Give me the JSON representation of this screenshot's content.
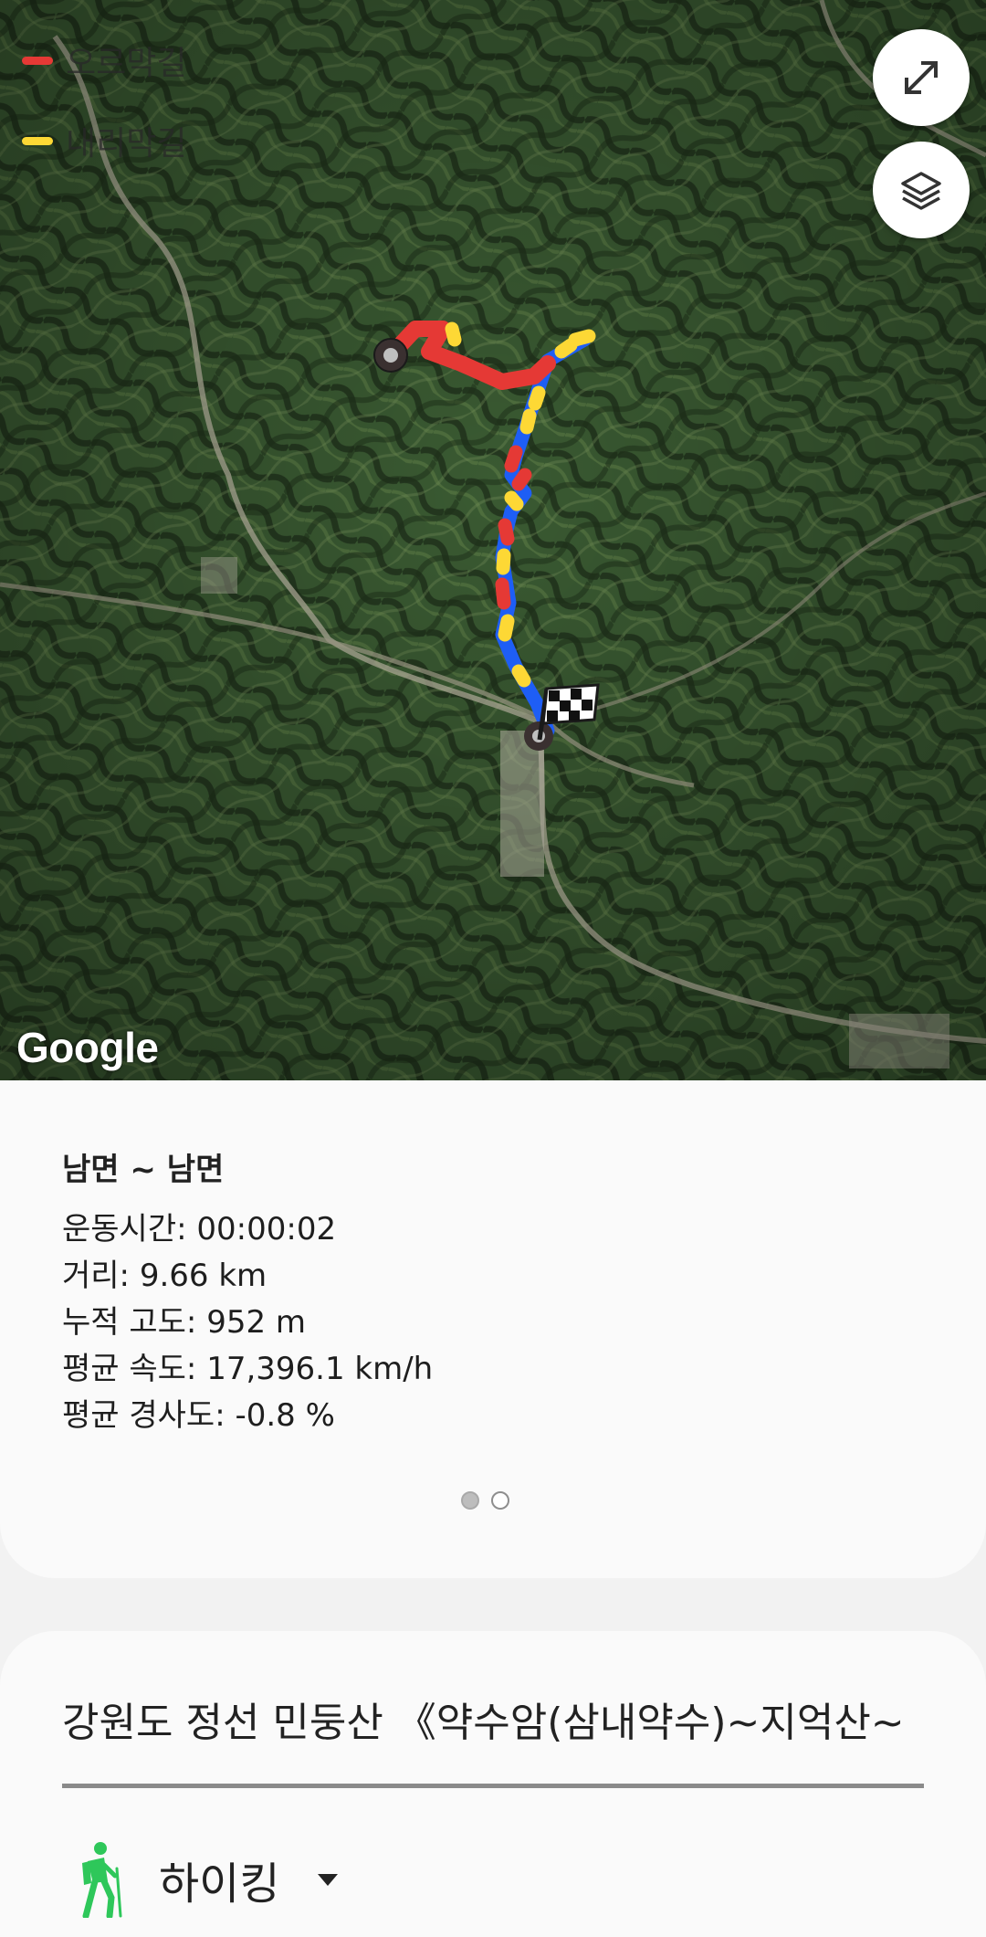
{
  "map": {
    "legend": [
      {
        "label": "오르막길",
        "color": "#e53935"
      },
      {
        "label": "내리막길",
        "color": "#fdd835"
      }
    ],
    "route_colors": {
      "uphill": "#e53935",
      "downhill": "#fdd835",
      "flat": "#1e5ef5"
    },
    "expand_button_icon": "expand-arrows-icon",
    "layers_button_icon": "layers-icon",
    "attribution": "Google"
  },
  "summary": {
    "route_name": "남면 ~ 남면",
    "stats": [
      "운동시간: 00:00:02",
      "거리: 9.66 km",
      "누적 고도: 952 m",
      "평균 속도: 17,396.1 km/h",
      "평균 경사도: -0.8 %"
    ],
    "pager": {
      "current": 1,
      "total": 2
    }
  },
  "details": {
    "title_value": "강원도 정선 민둥산 《약수암(삼내약수)~지억산~",
    "activity_label": "하이킹",
    "activity_icon": "hiking-person-icon",
    "accent": "#2ec75a"
  }
}
